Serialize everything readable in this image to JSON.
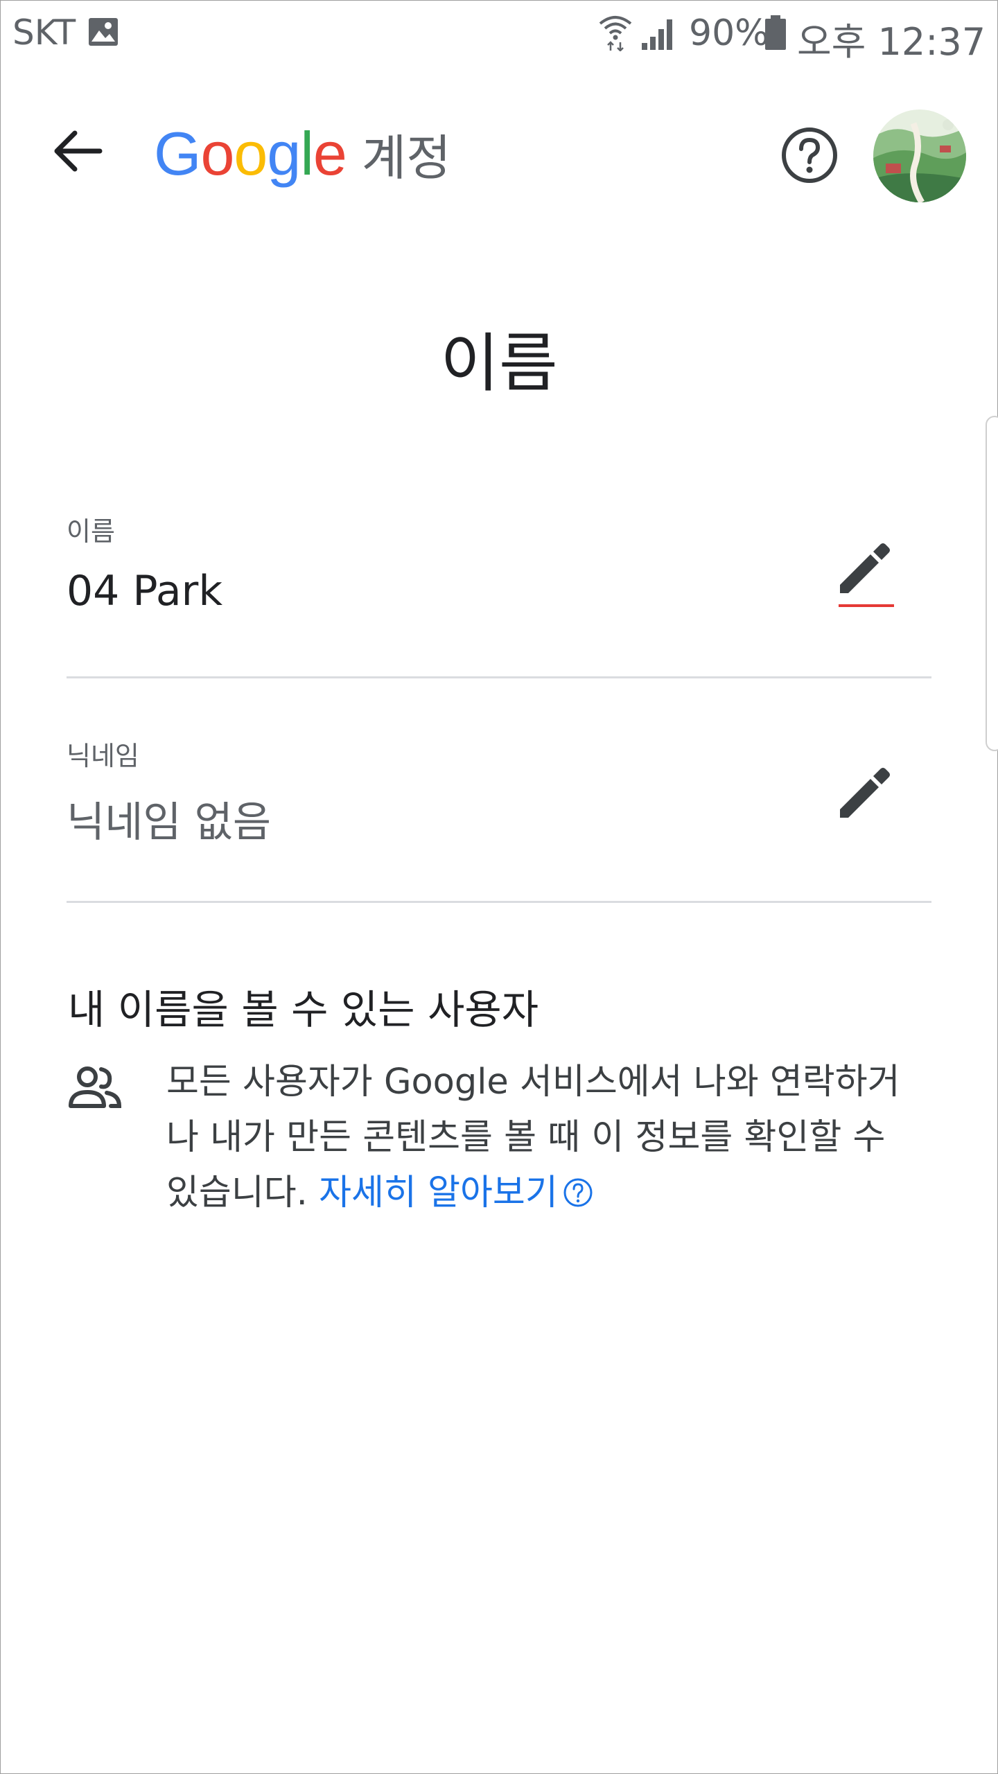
{
  "status_bar": {
    "carrier": "SKT",
    "battery_percent": "90%",
    "time": "오후 12:37"
  },
  "app_bar": {
    "back_icon": "arrow-back-icon",
    "logo_letters": [
      {
        "char": "G",
        "color": "#4285F4"
      },
      {
        "char": "o",
        "color": "#EA4335"
      },
      {
        "char": "o",
        "color": "#FBBC05"
      },
      {
        "char": "g",
        "color": "#4285F4"
      },
      {
        "char": "l",
        "color": "#34A853"
      },
      {
        "char": "e",
        "color": "#EA4335"
      }
    ],
    "account_label": "계정",
    "help_icon": "help-circle-icon"
  },
  "page_title": "이름",
  "fields": {
    "name": {
      "label": "이름",
      "value": "04 Park",
      "value_color": "#202124"
    },
    "nickname": {
      "label": "닉네임",
      "value": "닉네임 없음",
      "value_color": "#5f6368"
    }
  },
  "visibility": {
    "title": "내 이름을 볼 수 있는 사용자",
    "description_line1": "모든 사용자가 Google 서비스에서 나와 연락하거",
    "description_line2": "나 내가 만든 콘텐츠를 볼 때 이 정보를 확인할 수",
    "description_line3": "있습니다. ",
    "link_text": "자세히 알아보기"
  },
  "colors": {
    "accent_link": "#1a73e8",
    "focus_underline": "#e53935",
    "icon_dark": "#3c4043"
  }
}
